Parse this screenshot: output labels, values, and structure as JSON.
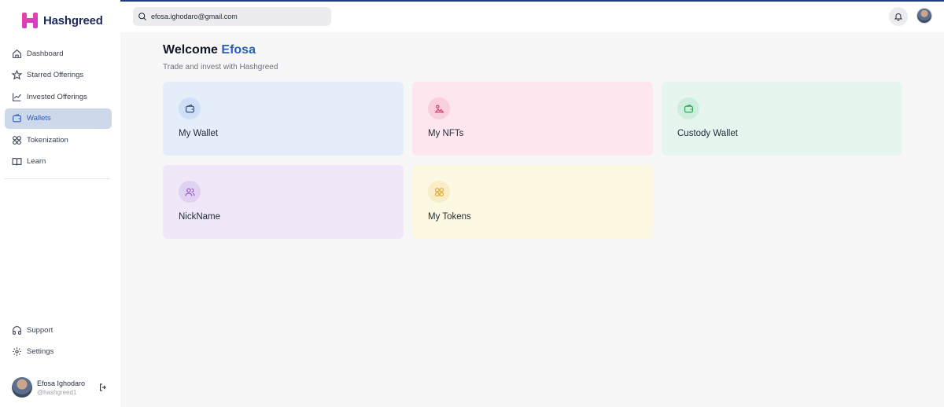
{
  "brand": {
    "name": "Hashgreed"
  },
  "search": {
    "value": "efosa.ighodaro@gmail.com"
  },
  "sidebar": {
    "items": [
      {
        "label": "Dashboard",
        "icon": "home-icon"
      },
      {
        "label": "Starred Offerings",
        "icon": "star-icon"
      },
      {
        "label": "Invested Offerings",
        "icon": "chart-line-icon"
      },
      {
        "label": "Wallets",
        "icon": "wallet-icon",
        "active": true
      },
      {
        "label": "Tokenization",
        "icon": "grid-icon"
      },
      {
        "label": "Learn",
        "icon": "book-icon"
      }
    ],
    "bottom_items": [
      {
        "label": "Support",
        "icon": "headphones-icon"
      },
      {
        "label": "Settings",
        "icon": "gear-icon"
      }
    ]
  },
  "user": {
    "name": "Efosa Ighodaro",
    "handle": "@hashgreed1"
  },
  "main": {
    "welcome_prefix": "Welcome",
    "welcome_name": "Efosa",
    "subtitle": "Trade and invest with Hashgreed",
    "cards": [
      {
        "label": "My Wallet",
        "icon": "wallet-icon",
        "bg": "#e4eefa",
        "icon_bg": "#cfe0f5",
        "icon_color": "#2b3f6b"
      },
      {
        "label": "My NFTs",
        "icon": "image-icon",
        "bg": "#fde6ee",
        "icon_bg": "#f9cfdc",
        "icon_color": "#d0306b"
      },
      {
        "label": "Custody Wallet",
        "icon": "wallet-icon",
        "bg": "#e6f6ee",
        "icon_bg": "#cdeedd",
        "icon_color": "#1f9d55"
      },
      {
        "label": "NickName",
        "icon": "users-icon",
        "bg": "#f0e7f8",
        "icon_bg": "#e2d2f2",
        "icon_color": "#8e4cc4"
      },
      {
        "label": "My Tokens",
        "icon": "grid-icon",
        "bg": "#fdf8e1",
        "icon_bg": "#f9ecc6",
        "icon_color": "#e0a222"
      }
    ]
  },
  "colors": {
    "accent": "#2b5fb7",
    "brand": "#e4409b",
    "active_bg": "#cdd8ea"
  }
}
